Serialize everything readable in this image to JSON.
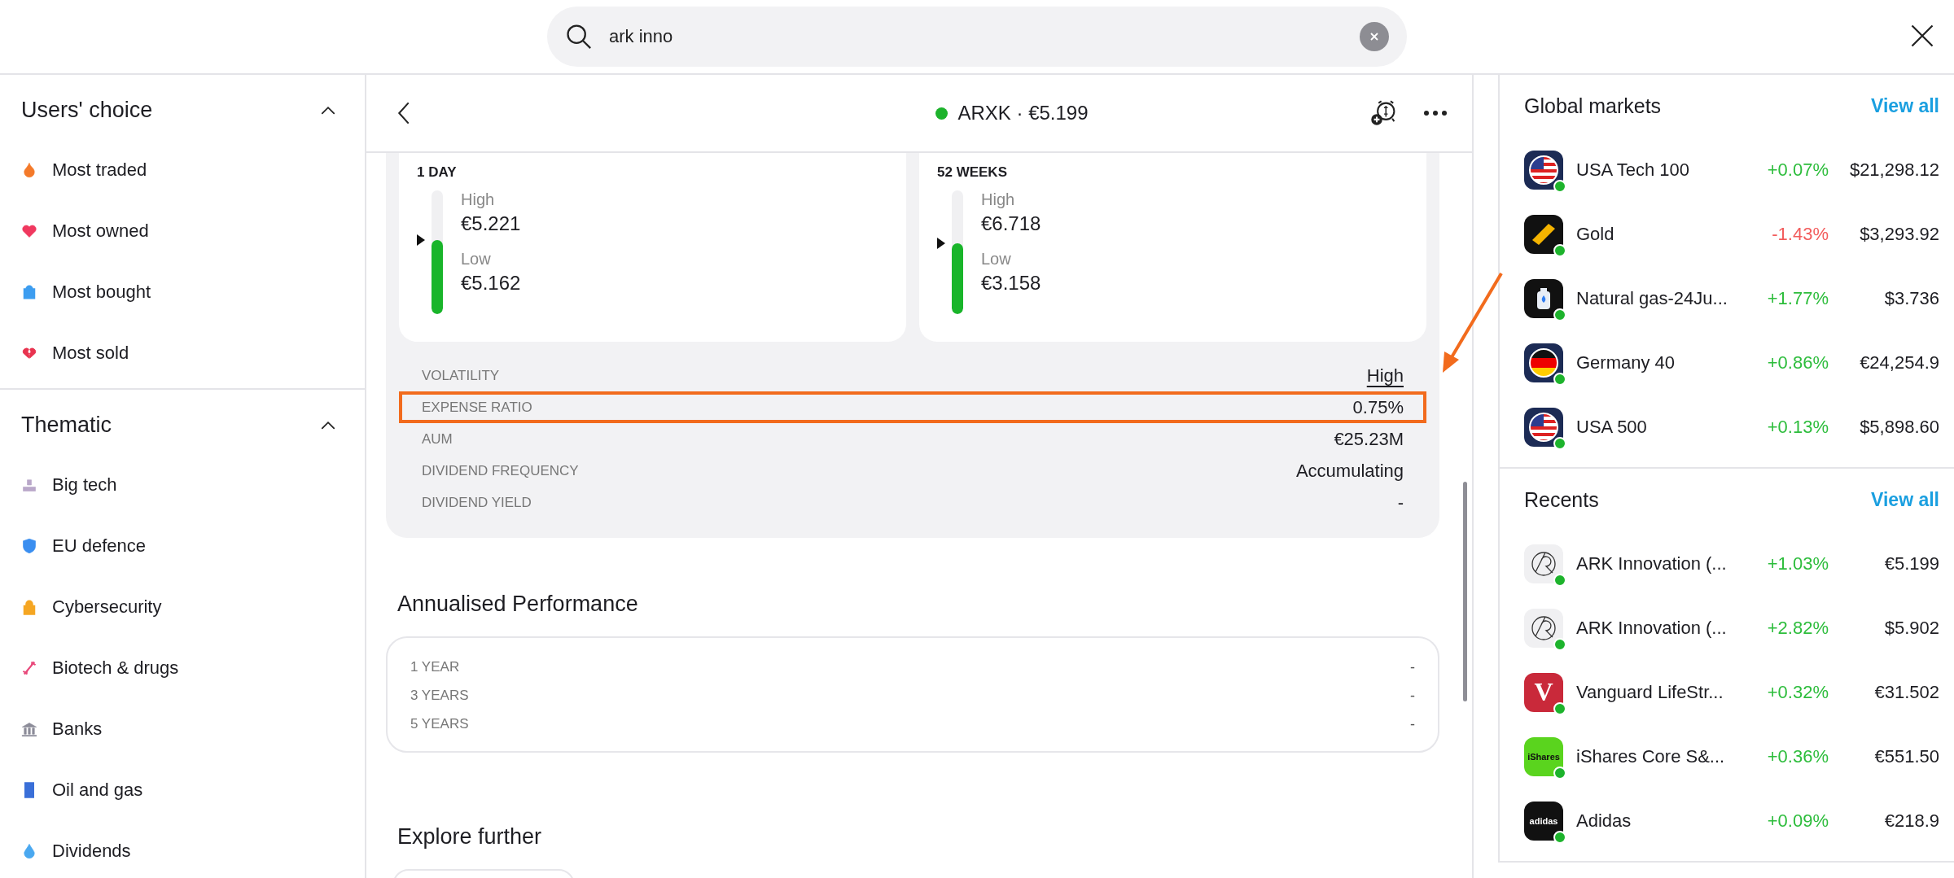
{
  "search": {
    "value": "ark inno"
  },
  "sidebar": {
    "sections": [
      {
        "title": "Users' choice",
        "expanded": true,
        "items": [
          {
            "label": "Most traded"
          },
          {
            "label": "Most owned"
          },
          {
            "label": "Most bought"
          },
          {
            "label": "Most sold"
          }
        ]
      },
      {
        "title": "Thematic",
        "expanded": true,
        "items": [
          {
            "label": "Big tech"
          },
          {
            "label": "EU defence"
          },
          {
            "label": "Cybersecurity"
          },
          {
            "label": "Biotech & drugs"
          },
          {
            "label": "Banks"
          },
          {
            "label": "Oil and gas"
          },
          {
            "label": "Dividends"
          }
        ]
      }
    ]
  },
  "detail": {
    "title": "ARXK · €5.199",
    "ranges": [
      {
        "title": "1 DAY",
        "high_label": "High",
        "high": "€5.221",
        "low_label": "Low",
        "low": "€5.162",
        "level": 0.6
      },
      {
        "title": "52 WEEKS",
        "high_label": "High",
        "high": "€6.718",
        "low_label": "Low",
        "low": "€3.158",
        "level": 0.57
      }
    ],
    "stats": [
      {
        "label": "VOLATILITY",
        "value": "High",
        "highlighted": false
      },
      {
        "label": "EXPENSE RATIO",
        "value": "0.75%",
        "highlighted": true
      },
      {
        "label": "AUM",
        "value": "€25.23M",
        "highlighted": false
      },
      {
        "label": "DIVIDEND FREQUENCY",
        "value": "Accumulating",
        "highlighted": false
      },
      {
        "label": "DIVIDEND YIELD",
        "value": "-",
        "highlighted": false
      }
    ],
    "performance": {
      "title": "Annualised Performance",
      "rows": [
        {
          "label": "1 YEAR",
          "value": "-"
        },
        {
          "label": "3 YEARS",
          "value": "-"
        },
        {
          "label": "5 YEARS",
          "value": "-"
        }
      ]
    },
    "explore_title": "Explore further"
  },
  "panels": [
    {
      "title": "Global markets",
      "link": "View all",
      "items": [
        {
          "name": "USA Tech 100",
          "change": "+0.07%",
          "color": "#2dbd3c",
          "price": "$21,298.12"
        },
        {
          "name": "Gold",
          "change": "-1.43%",
          "color": "#f25c5c",
          "price": "$3,293.92"
        },
        {
          "name": "Natural gas-24Ju...",
          "change": "+1.77%",
          "color": "#2dbd3c",
          "price": "$3.736"
        },
        {
          "name": "Germany 40",
          "change": "+0.86%",
          "color": "#2dbd3c",
          "price": "€24,254.9"
        },
        {
          "name": "USA 500",
          "change": "+0.13%",
          "color": "#2dbd3c",
          "price": "$5,898.60"
        }
      ]
    },
    {
      "title": "Recents",
      "link": "View all",
      "items": [
        {
          "name": "ARK Innovation (...",
          "change": "+1.03%",
          "color": "#2dbd3c",
          "price": "€5.199"
        },
        {
          "name": "ARK Innovation (...",
          "change": "+2.82%",
          "color": "#2dbd3c",
          "price": "$5.902"
        },
        {
          "name": "Vanguard LifeStr...",
          "change": "+0.32%",
          "color": "#2dbd3c",
          "price": "€31.502",
          "logo_text": "V"
        },
        {
          "name": "iShares Core S&...",
          "change": "+0.36%",
          "color": "#2dbd3c",
          "price": "€551.50",
          "logo_text": "iShares"
        },
        {
          "name": "Adidas",
          "change": "+0.09%",
          "color": "#2dbd3c",
          "price": "€218.9",
          "logo_text": "adidas"
        }
      ]
    }
  ]
}
